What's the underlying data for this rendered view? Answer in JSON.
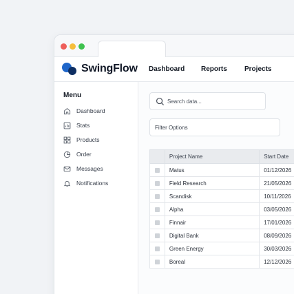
{
  "app": {
    "brand": "SwingFlow"
  },
  "nav": {
    "items": [
      "Dashboard",
      "Reports",
      "Projects"
    ]
  },
  "sidebar": {
    "title": "Menu",
    "items": [
      {
        "label": "Dashboard",
        "icon": "home-icon"
      },
      {
        "label": "Stats",
        "icon": "stats-icon"
      },
      {
        "label": "Products",
        "icon": "grid-icon"
      },
      {
        "label": "Order",
        "icon": "pie-chart-icon"
      },
      {
        "label": "Messages",
        "icon": "mail-icon"
      },
      {
        "label": "Notifications",
        "icon": "bell-icon"
      }
    ]
  },
  "search": {
    "placeholder": "Search data..."
  },
  "filter": {
    "label": "Filter Options"
  },
  "table": {
    "columns": [
      "Project Name",
      "Start Date"
    ],
    "rows": [
      {
        "name": "Matus",
        "date": "01/12/2026"
      },
      {
        "name": "Field Research",
        "date": "21/05/2026"
      },
      {
        "name": "Scandisk",
        "date": "10/11/2026"
      },
      {
        "name": "Alpha",
        "date": "03/05/2026"
      },
      {
        "name": "Finnair",
        "date": "17/01/2026"
      },
      {
        "name": "Digital Bank",
        "date": "08/09/2026"
      },
      {
        "name": "Green Energy",
        "date": "30/03/2026"
      },
      {
        "name": "Boreal",
        "date": "12/12/2026"
      }
    ]
  },
  "colors": {
    "brand_primary": "#1f66c9",
    "brand_dark": "#0e2f63",
    "window_close": "#ee5f5b",
    "window_minimize": "#f6be3b",
    "window_maximize": "#3fc24f"
  }
}
